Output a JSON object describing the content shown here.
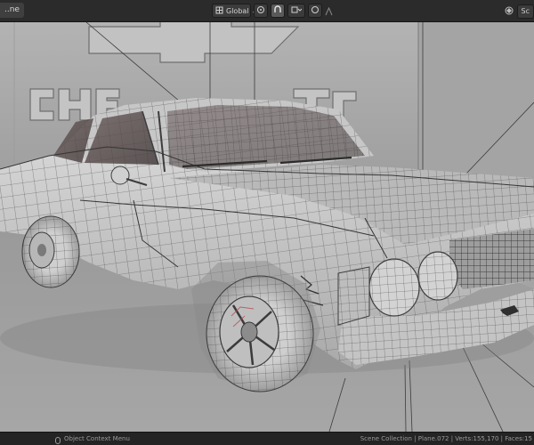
{
  "header": {
    "left_tab_label": "..ne",
    "transform_orientation": "Global",
    "chevron": "⌄",
    "scene_label": "Sc",
    "icons": [
      "global-orientation-icon",
      "pivot-icon",
      "snap-icon",
      "proportional-edit-icon",
      "overlay-icon"
    ]
  },
  "viewport": {
    "mode": "wireframe-overlay",
    "object_color": "#c9c9c9",
    "wire_color": "#4a4a4a"
  },
  "status": {
    "left_text": "Object Context Menu",
    "right_text": "Scene Collection | Plane.072 | Verts:155,170 | Faces:15"
  },
  "colors": {
    "header_bg": "#2b2b2b",
    "viewport_bg": "#8d8d8d",
    "status_bg": "#242424"
  }
}
